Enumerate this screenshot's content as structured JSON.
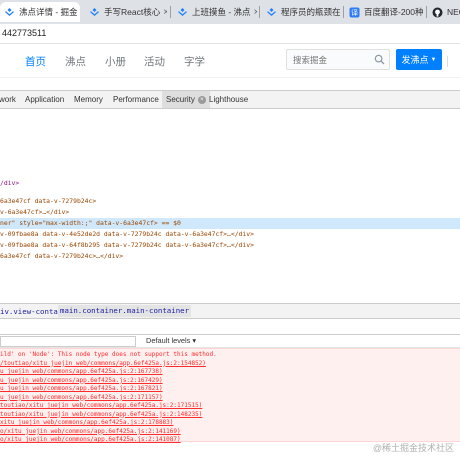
{
  "browser": {
    "tabs": [
      {
        "label": "沸点详情 - 掘金",
        "icon": "juejin-icon",
        "active": true
      },
      {
        "label": "手写React核心",
        "icon": "juejin-icon",
        "active": false
      },
      {
        "label": "上班摸鱼 - 沸点",
        "icon": "juejin-icon",
        "active": false
      },
      {
        "label": "程序员的瓶颈在",
        "icon": "juejin-icon",
        "active": false
      },
      {
        "label": "百度翻译-200种",
        "icon": "baidu-translate-icon",
        "active": false
      },
      {
        "label": "NEO",
        "icon": "github-icon",
        "active": false
      }
    ],
    "url": "442773511"
  },
  "site": {
    "nav": [
      "首页",
      "沸点",
      "小册",
      "活动",
      "字学"
    ],
    "search_placeholder": "搜索掘金",
    "publish_label": "发沸点",
    "accent": "#007fff"
  },
  "devtools": {
    "tabs": [
      "work",
      "Application",
      "Memory",
      "Performance",
      "Security",
      "Lighthouse"
    ],
    "selected_tab": "Security",
    "tree_lines": [
      "/div>",
      "6a3e47cf data-v-7279b24c>",
      "v-6a3e47cf>…</div>",
      "ner\" style=\"max-width:;\" data-v-6a3e47cf> == $0",
      "v-09fbae8a data-v-4e52de2d data-v-7279b24c data-v-6a3e47cf>…</div>",
      "v-09fbae8a data-v-64f8b295 data-v-7279b24c data-v-6a3e47cf>…</div>",
      "6a3e47cf data-v-7279b24c>…</div>"
    ],
    "breadcrumbs": [
      "iv.view-container",
      "main.container.main-container"
    ],
    "console": {
      "levels_label": "Default levels ▾",
      "error_lines": [
        "ild' on 'Node': This node type does not support this method.",
        "/toutiao/xitu_juejin_web/commons/app.6ef425a.js:2:154852)",
        "u_juejin_web/commons/app.6ef425a.js:2:167738)",
        "u_juejin_web/commons/app.6ef425a.js:2:167429)",
        "u_juejin_web/commons/app.6ef425a.js:2:167821)",
        "u_juejin_web/commons/app.6ef425a.js:2:171157)",
        "toutiao/xitu_juejin_web/commons/app.6ef425a.js:2:171515)",
        "toutiao/xitu_juejin_web/commons/app.6ef425a.js:2:148235)",
        "xitu_juejin_web/commons/app.6ef425a.js:2:178883)",
        "o/xitu_juejin_web/commons/app.6ef425a.js:2:141169)",
        "o/xitu_juejin_web/commons/app.6ef425a.js:2:141087)"
      ]
    }
  },
  "watermark": "@稀土掘金技术社区"
}
